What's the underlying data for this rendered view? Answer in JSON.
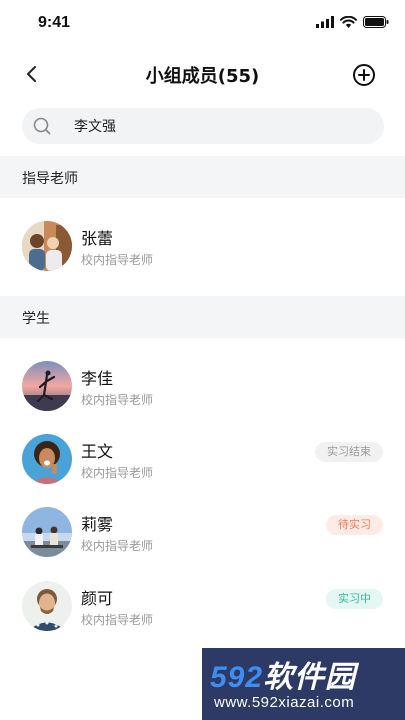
{
  "status_bar": {
    "time": "9:41"
  },
  "nav": {
    "title": "小组成员(55)"
  },
  "search": {
    "value": "李文强"
  },
  "sections": {
    "teachers": {
      "title": "指导老师",
      "members": [
        {
          "name": "张蕾",
          "role": "校内指导老师"
        }
      ]
    },
    "students": {
      "title": "学生",
      "members": [
        {
          "name": "李佳",
          "role": "校内指导老师",
          "badge": ""
        },
        {
          "name": "王文",
          "role": "校内指导老师",
          "badge": "实习结束"
        },
        {
          "name": "莉雾",
          "role": "校内指导老师",
          "badge": "待实习"
        },
        {
          "name": "颜可",
          "role": "校内指导老师",
          "badge": "实习中"
        }
      ]
    }
  },
  "colors": {
    "badge_ended": "#9a9a9a",
    "badge_pending": "#ef7a54",
    "badge_active": "#2fb89a",
    "section_bg": "#f4f5f7"
  },
  "watermark": {
    "brand_num": "592",
    "brand_cn": "软件园",
    "url": "www.592xiazai.com"
  }
}
